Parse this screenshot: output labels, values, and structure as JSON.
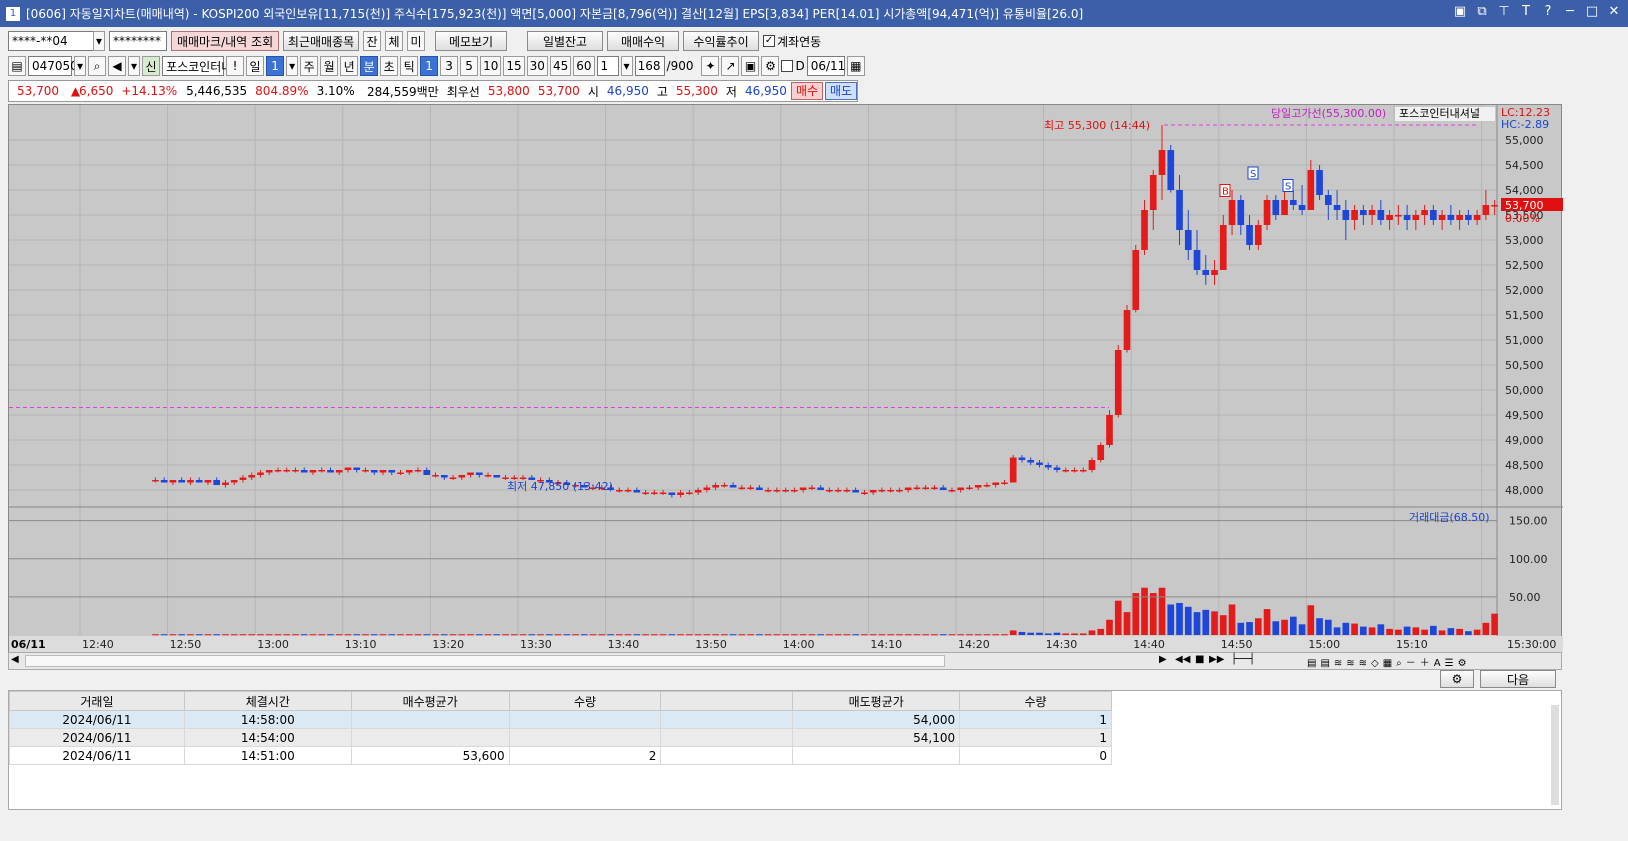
{
  "window": {
    "title": "[0606] 자동일지차트(매매내역) - KOSPI200 외국인보유[11,715(천)] 주식수[175,923(천)] 액면[5,000] 자본금[8,796(억)] 결산[12월] EPS[3,834] PER[14.01] 시가총액[94,471(억)] 유통비율[26.0]",
    "app_icon": "1"
  },
  "toolbar1": {
    "account": "****-**04",
    "password": "********",
    "mark_btn": "매매마크/내역 조회",
    "recent_btn": "최근매매종목",
    "b1": "잔",
    "b2": "체",
    "b3": "미",
    "memo_btn": "메모보기",
    "daily_btn": "일별잔고",
    "profit_btn": "매매수익",
    "trend_btn": "수익률추이",
    "link_label": "계좌연동"
  },
  "toolbar2": {
    "code": "047050",
    "name": "포스코인터내",
    "exclaim": "!",
    "p_day": "일",
    "p_day_n": "1",
    "p_week": "주",
    "p_month": "월",
    "p_year": "년",
    "p_min": "분",
    "p_sec": "초",
    "p_tick": "틱",
    "intervals": [
      "1",
      "3",
      "5",
      "10",
      "15",
      "30",
      "45",
      "60"
    ],
    "count_sel": "1",
    "display_count": "168",
    "max_count": "/900",
    "d_label": "D",
    "date": "06/11"
  },
  "quote": {
    "price": "53,700",
    "change": "6,650",
    "rate": "+14.13%",
    "volume": "5,446,535",
    "vol_rate": "804.89%",
    "turnover": "3.10%",
    "amount": "284,559백만",
    "ask_label": "최우선",
    "ask": "53,800",
    "bid": "53,700",
    "open_label": "시",
    "open": "46,950",
    "high_label": "고",
    "high": "55,300",
    "low_label": "저",
    "low": "46,950",
    "buy_btn": "매수",
    "sell_btn": "매도"
  },
  "chart_labels": {
    "prevhigh": "당일고가선(55,300.00)",
    "stock": "포스코인터내셔널",
    "lc": "LC:12.23",
    "hc": "HC:-2.89",
    "high_ann": "최고 55,300 (14:44)",
    "low_ann": "최저 47,850 (13:42)",
    "cur_price": "53,700",
    "cur_pct": "0.00%",
    "vol_title": "거래대금(68.50)",
    "date_label": "06/11",
    "close_time": "15:30:00",
    "sell_mark": "S",
    "buy_mark": "B"
  },
  "price_ticks": [
    "55,000",
    "54,500",
    "54,000",
    "53,500",
    "53,000",
    "52,500",
    "52,000",
    "51,500",
    "51,000",
    "50,500",
    "50,000",
    "49,500",
    "49,000",
    "48,500",
    "48,000"
  ],
  "vol_ticks": [
    "150.00",
    "100.00",
    "50.00"
  ],
  "time_ticks": [
    "12:40",
    "12:50",
    "13:00",
    "13:10",
    "13:20",
    "13:30",
    "13:40",
    "13:50",
    "14:00",
    "14:10",
    "14:20",
    "14:30",
    "14:40",
    "14:50",
    "15:00",
    "15:10"
  ],
  "bottom_btn": "다음",
  "table": {
    "headers": [
      "거래일",
      "체결시간",
      "매수평균가",
      "수량",
      "",
      "매도평균가",
      "수량"
    ],
    "rows": [
      [
        "2024/06/11",
        "14:58:00",
        "",
        "",
        "",
        "54,000",
        "1"
      ],
      [
        "2024/06/11",
        "14:54:00",
        "",
        "",
        "",
        "54,100",
        "1"
      ],
      [
        "2024/06/11",
        "14:51:00",
        "53,600",
        "2",
        "",
        "",
        "0"
      ]
    ]
  },
  "chart_data": {
    "type": "candlestick",
    "symbol": "포스코인터내셔널",
    "interval_min": 1,
    "ylim": [
      47700,
      55700
    ],
    "y2lim": [
      0,
      160
    ],
    "prev_high_line": 55300,
    "prev_close_line": 49650,
    "x_start": "12:35",
    "x_end": "15:30",
    "candles": [
      [
        48200,
        48250,
        48150,
        48200,
        1
      ],
      [
        48200,
        48250,
        48150,
        48150,
        1
      ],
      [
        48150,
        48200,
        48100,
        48200,
        1
      ],
      [
        48200,
        48250,
        48150,
        48150,
        1
      ],
      [
        48150,
        48250,
        48100,
        48200,
        1
      ],
      [
        48200,
        48250,
        48150,
        48150,
        1
      ],
      [
        48150,
        48200,
        48100,
        48200,
        1
      ],
      [
        48200,
        48250,
        48100,
        48100,
        1
      ],
      [
        48100,
        48200,
        48050,
        48150,
        1
      ],
      [
        48150,
        48200,
        48100,
        48200,
        1
      ],
      [
        48200,
        48300,
        48150,
        48250,
        1
      ],
      [
        48250,
        48350,
        48200,
        48300,
        1
      ],
      [
        48300,
        48400,
        48250,
        48350,
        1
      ],
      [
        48350,
        48400,
        48300,
        48400,
        1
      ],
      [
        48400,
        48450,
        48350,
        48400,
        1
      ],
      [
        48400,
        48450,
        48350,
        48400,
        1
      ],
      [
        48400,
        48450,
        48350,
        48400,
        1
      ],
      [
        48400,
        48450,
        48350,
        48350,
        1
      ],
      [
        48350,
        48400,
        48300,
        48400,
        1
      ],
      [
        48400,
        48450,
        48350,
        48400,
        1
      ],
      [
        48400,
        48450,
        48350,
        48350,
        1
      ],
      [
        48350,
        48400,
        48300,
        48400,
        1
      ],
      [
        48400,
        48450,
        48350,
        48450,
        1
      ],
      [
        48450,
        48450,
        48350,
        48400,
        1
      ],
      [
        48400,
        48450,
        48350,
        48400,
        1
      ],
      [
        48400,
        48400,
        48300,
        48350,
        1
      ],
      [
        48350,
        48400,
        48300,
        48400,
        1
      ],
      [
        48400,
        48400,
        48300,
        48350,
        1
      ],
      [
        48350,
        48400,
        48300,
        48350,
        1
      ],
      [
        48350,
        48400,
        48300,
        48400,
        1
      ],
      [
        48400,
        48450,
        48350,
        48400,
        1
      ],
      [
        48400,
        48450,
        48300,
        48300,
        1
      ],
      [
        48300,
        48350,
        48250,
        48300,
        1
      ],
      [
        48300,
        48300,
        48200,
        48250,
        1
      ],
      [
        48250,
        48300,
        48200,
        48250,
        1
      ],
      [
        48250,
        48300,
        48200,
        48300,
        1
      ],
      [
        48300,
        48350,
        48250,
        48350,
        1
      ],
      [
        48350,
        48350,
        48250,
        48300,
        1
      ],
      [
        48300,
        48350,
        48250,
        48300,
        1
      ],
      [
        48300,
        48300,
        48250,
        48250,
        1
      ],
      [
        48250,
        48300,
        48200,
        48250,
        1
      ],
      [
        48250,
        48300,
        48200,
        48250,
        1
      ],
      [
        48250,
        48300,
        48200,
        48250,
        1
      ],
      [
        48250,
        48300,
        48200,
        48200,
        1
      ],
      [
        48200,
        48250,
        48150,
        48200,
        1
      ],
      [
        48200,
        48250,
        48150,
        48150,
        1
      ],
      [
        48150,
        48200,
        48100,
        48150,
        1
      ],
      [
        48150,
        48200,
        48100,
        48100,
        1
      ],
      [
        48100,
        48150,
        48050,
        48100,
        1
      ],
      [
        48100,
        48150,
        48050,
        48050,
        1
      ],
      [
        48050,
        48100,
        48000,
        48050,
        1
      ],
      [
        48050,
        48100,
        48000,
        48050,
        1
      ],
      [
        48050,
        48100,
        48000,
        48000,
        1
      ],
      [
        48000,
        48050,
        47950,
        48000,
        1
      ],
      [
        48000,
        48050,
        47950,
        48000,
        1
      ],
      [
        48000,
        48050,
        47950,
        47950,
        1
      ],
      [
        47950,
        48000,
        47900,
        47950,
        1
      ],
      [
        47950,
        48000,
        47900,
        47950,
        1
      ],
      [
        47950,
        48000,
        47900,
        47950,
        1
      ],
      [
        47950,
        47950,
        47850,
        47900,
        1
      ],
      [
        47900,
        48000,
        47850,
        47950,
        1
      ],
      [
        47950,
        48000,
        47900,
        47950,
        1
      ],
      [
        47950,
        48050,
        47900,
        48000,
        1
      ],
      [
        48000,
        48100,
        47950,
        48050,
        1
      ],
      [
        48050,
        48150,
        48000,
        48100,
        1
      ],
      [
        48100,
        48150,
        48050,
        48100,
        1
      ],
      [
        48100,
        48150,
        48050,
        48050,
        1
      ],
      [
        48050,
        48100,
        48000,
        48050,
        1
      ],
      [
        48050,
        48100,
        48000,
        48050,
        1
      ],
      [
        48050,
        48100,
        48000,
        48000,
        1
      ],
      [
        48000,
        48050,
        47950,
        48000,
        1
      ],
      [
        48000,
        48050,
        47950,
        48000,
        1
      ],
      [
        48000,
        48050,
        47950,
        48000,
        1
      ],
      [
        48000,
        48050,
        47950,
        48000,
        1
      ],
      [
        48000,
        48050,
        47950,
        48050,
        1
      ],
      [
        48050,
        48100,
        48000,
        48050,
        1
      ],
      [
        48050,
        48100,
        48000,
        48000,
        1
      ],
      [
        48000,
        48050,
        47950,
        48000,
        1
      ],
      [
        48000,
        48050,
        47950,
        48000,
        1
      ],
      [
        48000,
        48050,
        47950,
        48000,
        1
      ],
      [
        48000,
        48050,
        47950,
        47950,
        1
      ],
      [
        47950,
        48000,
        47900,
        47950,
        1
      ],
      [
        47950,
        48000,
        47900,
        48000,
        1
      ],
      [
        48000,
        48050,
        47950,
        48000,
        1
      ],
      [
        48000,
        48050,
        47950,
        48000,
        1
      ],
      [
        48000,
        48050,
        47950,
        48000,
        1
      ],
      [
        48000,
        48050,
        47950,
        48050,
        1
      ],
      [
        48050,
        48100,
        48000,
        48050,
        1
      ],
      [
        48050,
        48100,
        48000,
        48050,
        1
      ],
      [
        48050,
        48100,
        48000,
        48050,
        1
      ],
      [
        48050,
        48100,
        48000,
        48000,
        1
      ],
      [
        48000,
        48050,
        47950,
        48000,
        1
      ],
      [
        48000,
        48050,
        47950,
        48050,
        1
      ],
      [
        48050,
        48100,
        48000,
        48050,
        1
      ],
      [
        48050,
        48100,
        48000,
        48100,
        1
      ],
      [
        48100,
        48150,
        48050,
        48100,
        1
      ],
      [
        48100,
        48150,
        48050,
        48150,
        1
      ],
      [
        48150,
        48200,
        48100,
        48150,
        1
      ],
      [
        48150,
        48700,
        48150,
        48650,
        6
      ],
      [
        48650,
        48700,
        48550,
        48600,
        4
      ],
      [
        48600,
        48650,
        48500,
        48550,
        3
      ],
      [
        48550,
        48600,
        48450,
        48500,
        3
      ],
      [
        48500,
        48550,
        48400,
        48450,
        2
      ],
      [
        48450,
        48500,
        48350,
        48400,
        3
      ],
      [
        48400,
        48450,
        48350,
        48400,
        2
      ],
      [
        48400,
        48450,
        48350,
        48400,
        2
      ],
      [
        48400,
        48450,
        48350,
        48400,
        2
      ],
      [
        48400,
        48650,
        48350,
        48600,
        6
      ],
      [
        48600,
        48950,
        48550,
        48900,
        8
      ],
      [
        48900,
        49600,
        48850,
        49500,
        20
      ],
      [
        49500,
        50900,
        49450,
        50800,
        45
      ],
      [
        50800,
        51700,
        50750,
        51600,
        30
      ],
      [
        51600,
        52900,
        51550,
        52800,
        55
      ],
      [
        52800,
        53800,
        52700,
        53600,
        62
      ],
      [
        53600,
        54400,
        53200,
        54300,
        55
      ],
      [
        54300,
        55300,
        53800,
        54800,
        62
      ],
      [
        54800,
        54900,
        53950,
        54000,
        40
      ],
      [
        54000,
        54300,
        52900,
        53200,
        42
      ],
      [
        53200,
        53600,
        52600,
        52800,
        37
      ],
      [
        52800,
        53200,
        52300,
        52400,
        30
      ],
      [
        52400,
        52700,
        52100,
        52300,
        33
      ],
      [
        52300,
        52600,
        52100,
        52400,
        31
      ],
      [
        52400,
        53500,
        52400,
        53300,
        26
      ],
      [
        53300,
        54000,
        53100,
        53800,
        40
      ],
      [
        53800,
        53900,
        53100,
        53300,
        16
      ],
      [
        53300,
        53500,
        52800,
        52900,
        17
      ],
      [
        52900,
        53400,
        52800,
        53300,
        22
      ],
      [
        53300,
        53900,
        53200,
        53800,
        34
      ],
      [
        53800,
        53900,
        53400,
        53500,
        18
      ],
      [
        53500,
        54000,
        53500,
        53800,
        20
      ],
      [
        53800,
        54000,
        53600,
        53700,
        24
      ],
      [
        53700,
        54100,
        53500,
        53600,
        14
      ],
      [
        53600,
        54600,
        53600,
        54400,
        39
      ],
      [
        54400,
        54500,
        53800,
        53900,
        22
      ],
      [
        53900,
        54000,
        53400,
        53700,
        20
      ],
      [
        53700,
        54000,
        53400,
        53600,
        10
      ],
      [
        53600,
        53800,
        53000,
        53400,
        16
      ],
      [
        53400,
        53700,
        53200,
        53600,
        15
      ],
      [
        53600,
        53700,
        53300,
        53500,
        11
      ],
      [
        53500,
        53700,
        53300,
        53600,
        10
      ],
      [
        53600,
        53800,
        53300,
        53400,
        14
      ],
      [
        53400,
        53600,
        53200,
        53500,
        8
      ],
      [
        53500,
        53700,
        53300,
        53500,
        7
      ],
      [
        53500,
        53700,
        53200,
        53400,
        11
      ],
      [
        53400,
        53600,
        53200,
        53500,
        10
      ],
      [
        53500,
        53700,
        53300,
        53600,
        7
      ],
      [
        53600,
        53700,
        53300,
        53400,
        12
      ],
      [
        53400,
        53600,
        53200,
        53500,
        6
      ],
      [
        53500,
        53700,
        53300,
        53400,
        9
      ],
      [
        53400,
        53600,
        53200,
        53500,
        8
      ],
      [
        53500,
        53600,
        53300,
        53400,
        5
      ],
      [
        53400,
        53600,
        53300,
        53500,
        7
      ],
      [
        53500,
        54000,
        53400,
        53700,
        16
      ],
      [
        53700,
        53800,
        53500,
        53700,
        28
      ]
    ]
  }
}
